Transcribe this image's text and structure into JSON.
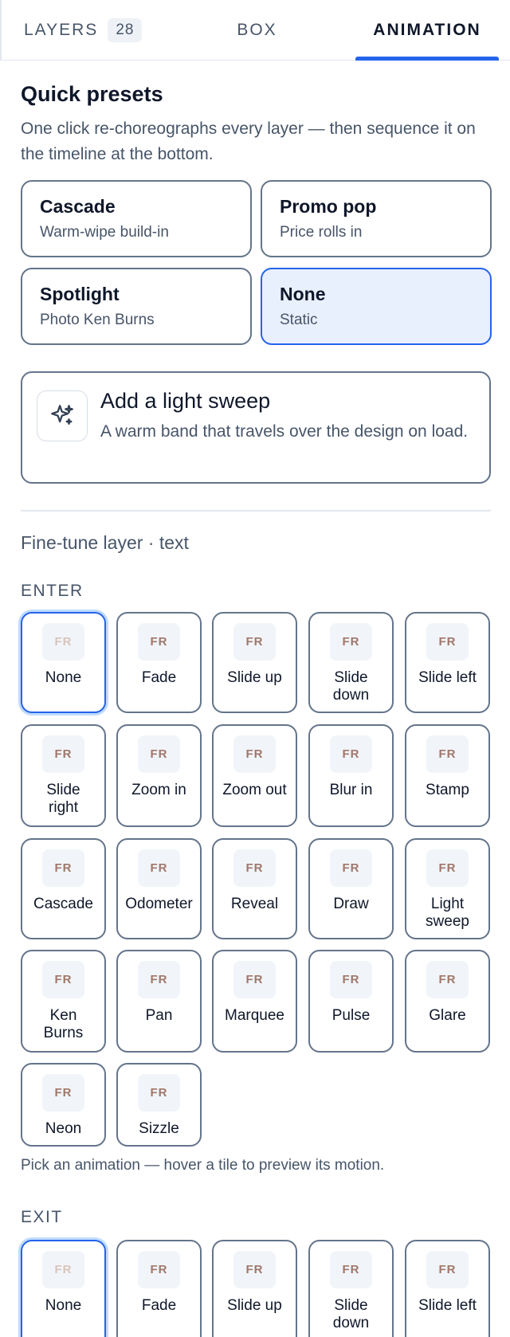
{
  "tabs": {
    "layers": "LAYERS",
    "layers_count": "28",
    "box": "BOX",
    "animation": "ANIMATION"
  },
  "quick_presets": {
    "title": "Quick presets",
    "description": "One click re-choreographs every layer — then sequence it on the timeline at the bottom.",
    "items": [
      {
        "name": "Cascade",
        "sub": "Warm-wipe build-in"
      },
      {
        "name": "Promo pop",
        "sub": "Price rolls in"
      },
      {
        "name": "Spotlight",
        "sub": "Photo Ken Burns"
      },
      {
        "name": "None",
        "sub": "Static"
      }
    ]
  },
  "light_sweep": {
    "title": "Add a light sweep",
    "description": "A warm band that travels over the design on load."
  },
  "fine_tune": "Fine-tune layer · text",
  "chip_text": "FR",
  "enter": {
    "label": "ENTER",
    "tiles": [
      "None",
      "Fade",
      "Slide up",
      "Slide down",
      "Slide left",
      "Slide right",
      "Zoom in",
      "Zoom out",
      "Blur in",
      "Stamp",
      "Cascade",
      "Odometer",
      "Reveal",
      "Draw",
      "Light sweep",
      "Ken Burns",
      "Pan",
      "Marquee",
      "Pulse",
      "Glare",
      "Neon",
      "Sizzle"
    ]
  },
  "hint": "Pick an animation — hover a tile to preview its motion.",
  "exit": {
    "label": "EXIT",
    "tiles": [
      "None",
      "Fade",
      "Slide up",
      "Slide down",
      "Slide left"
    ]
  },
  "colors": {
    "accent": "#2563eb",
    "active_preset_bg": "#e9f0fd",
    "chip_text": "#a0776a"
  }
}
